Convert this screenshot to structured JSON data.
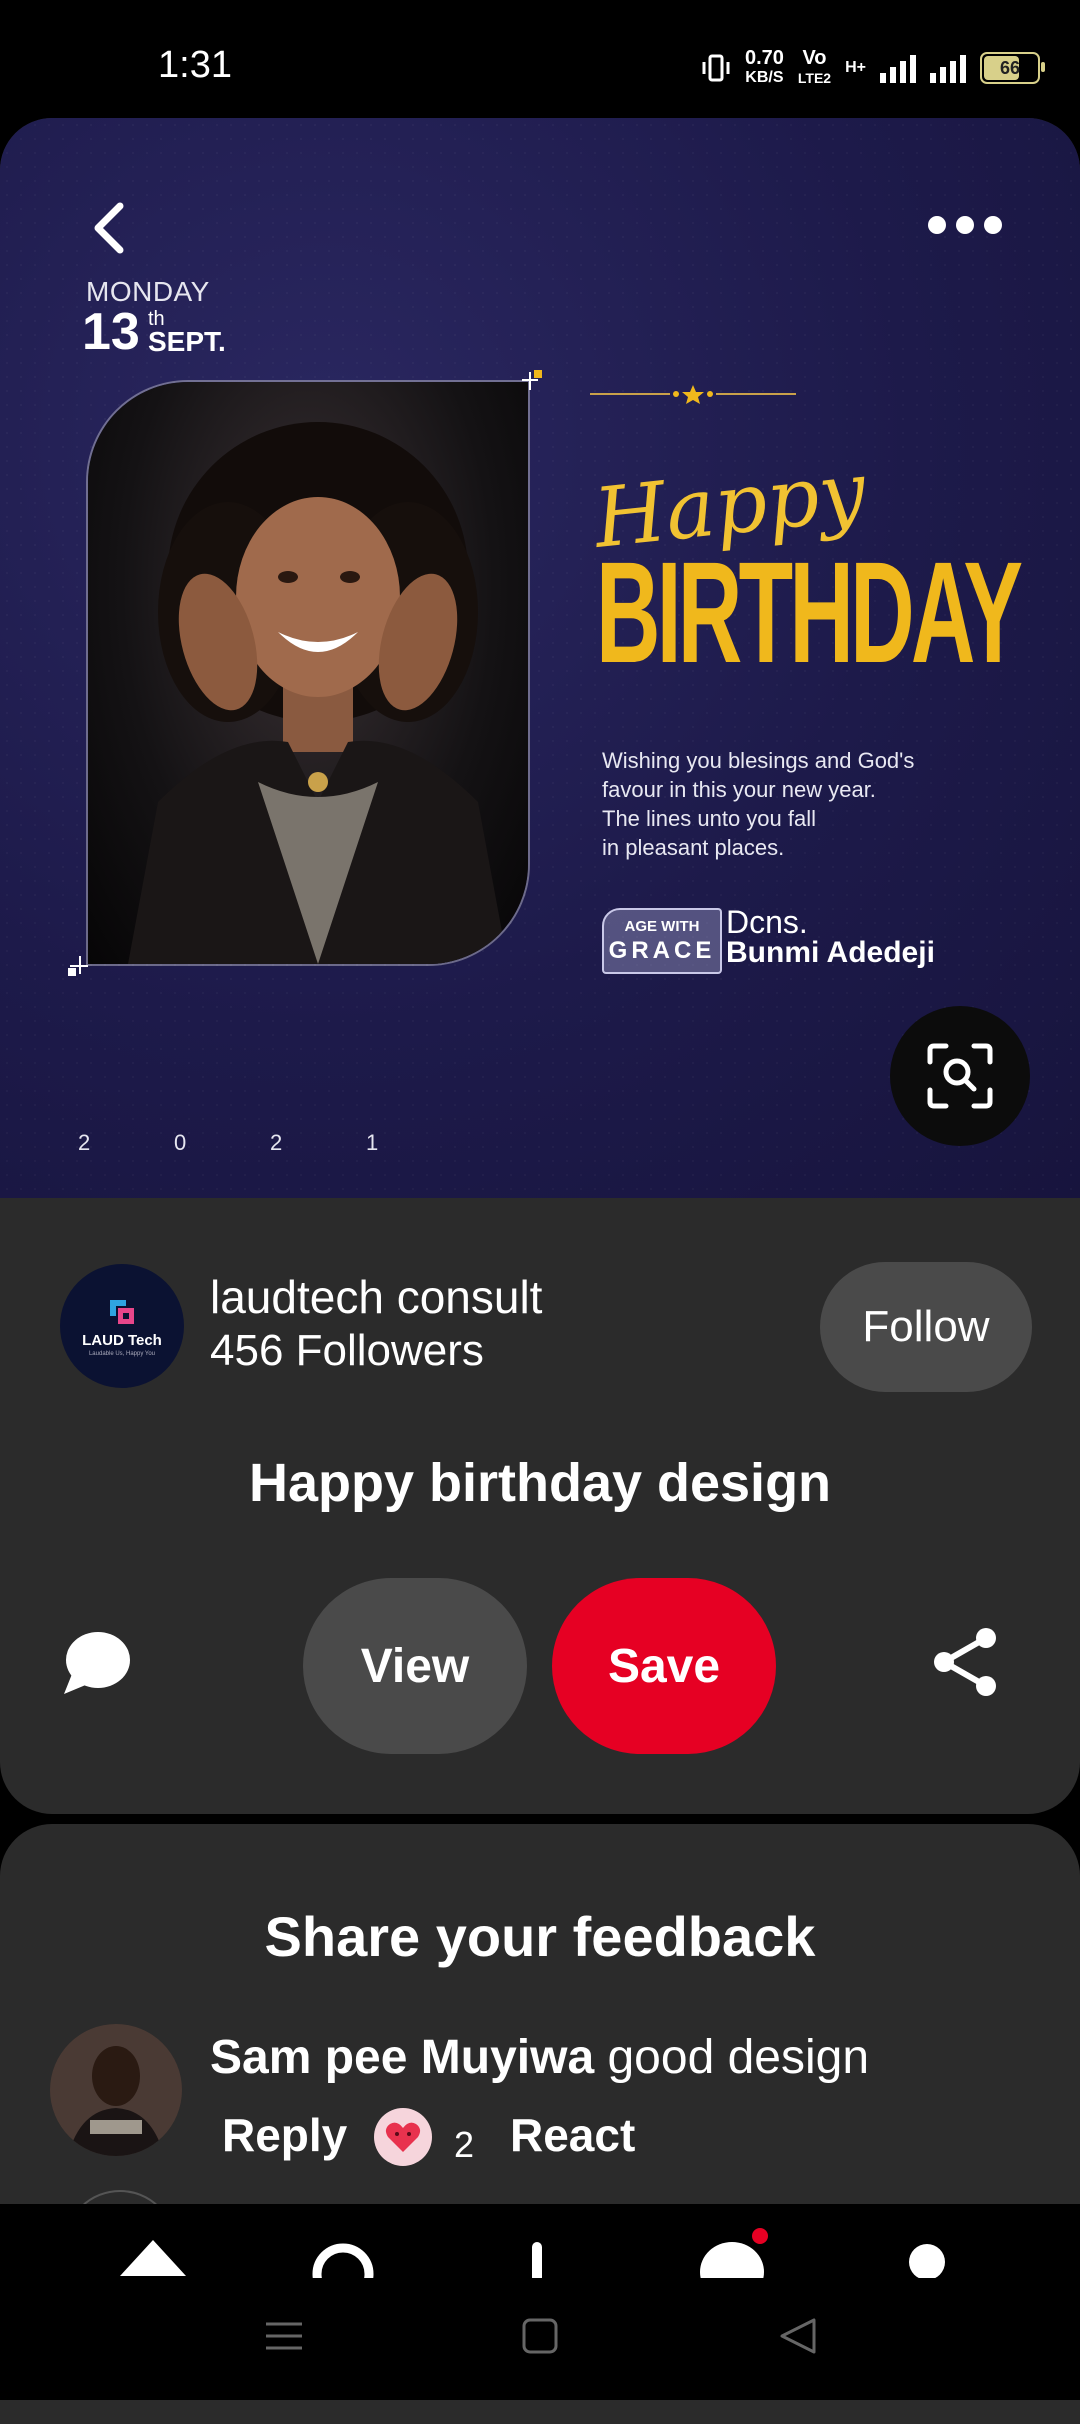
{
  "status_bar": {
    "time": "1:31",
    "net_speed": "0.70",
    "net_unit": "KB/S",
    "volte_top": "Vo",
    "volte_bottom": "LTE2",
    "hplus": "H+",
    "battery_level": "66"
  },
  "pin": {
    "image": {
      "date_day": "MONDAY",
      "date_num": "13",
      "date_suffix": "th",
      "date_month": "SEPT.",
      "happy": "Happy",
      "birthday": "BIRTHDAY",
      "wish_lines": [
        "Wishing you blesings and God's",
        "favour in this your new year.",
        "The lines unto you fall",
        "in pleasant places."
      ],
      "badge_top": "AGE WITH",
      "badge_bottom": "GRACE",
      "honoree_title": "Dcns.",
      "honoree_name": "Bunmi Adedeji",
      "year_digits": [
        "2",
        "0",
        "2",
        "1"
      ]
    },
    "creator": {
      "name": "laudtech consult",
      "followers": "456 Followers",
      "avatar_text": "LAUD Tech",
      "avatar_sub": "Laudable Us, Happy You",
      "follow_label": "Follow"
    },
    "title": "Happy birthday design",
    "actions": {
      "view_label": "View",
      "save_label": "Save"
    }
  },
  "feedback": {
    "title": "Share your feedback",
    "comment": {
      "author": "Sam pee Muyiwa",
      "text": " good design",
      "reply_label": "Reply",
      "react_count": "2",
      "react_label": "React"
    }
  },
  "colors": {
    "save_red": "#e60023",
    "card_bg": "#2b2b2b",
    "birthday_gold": "#f0b81c",
    "pin_bg_navy": "#1d1a4a"
  },
  "icons": {
    "back": "chevron-left-icon",
    "more": "more-horizontal-icon",
    "lens": "visual-search-icon",
    "comment": "comment-bubble-icon",
    "share": "share-icon",
    "heart": "heart-react-icon"
  }
}
